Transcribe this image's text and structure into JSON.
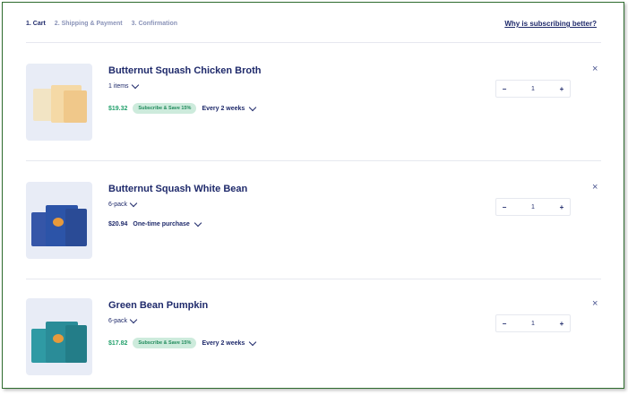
{
  "steps": [
    "1. Cart",
    "2. Shipping & Payment",
    "3. Confirmation"
  ],
  "why_link": "Why is subscribing better?",
  "items": [
    {
      "title": "Butternut Squash Chicken Broth",
      "variant": "1 items",
      "price": "$19.32",
      "purchase_type": "subscribe",
      "badge": "Subscribe & Save 15%",
      "frequency": "Every 2 weeks",
      "quantity": "1",
      "thumb_color": "#f3ead2"
    },
    {
      "title": "Butternut Squash White Bean",
      "variant": "6-pack",
      "price": "$20.94",
      "purchase_type": "one-time",
      "option": "One-time purchase",
      "quantity": "1",
      "thumb_color": "#2c54a8"
    },
    {
      "title": "Green Bean Pumpkin",
      "variant": "6-pack",
      "price": "$17.82",
      "purchase_type": "subscribe",
      "badge": "Subscribe & Save 15%",
      "frequency": "Every 2 weeks",
      "quantity": "1",
      "thumb_color": "#2a8c98"
    }
  ],
  "controls": {
    "minus": "−",
    "plus": "+",
    "remove": "×"
  }
}
